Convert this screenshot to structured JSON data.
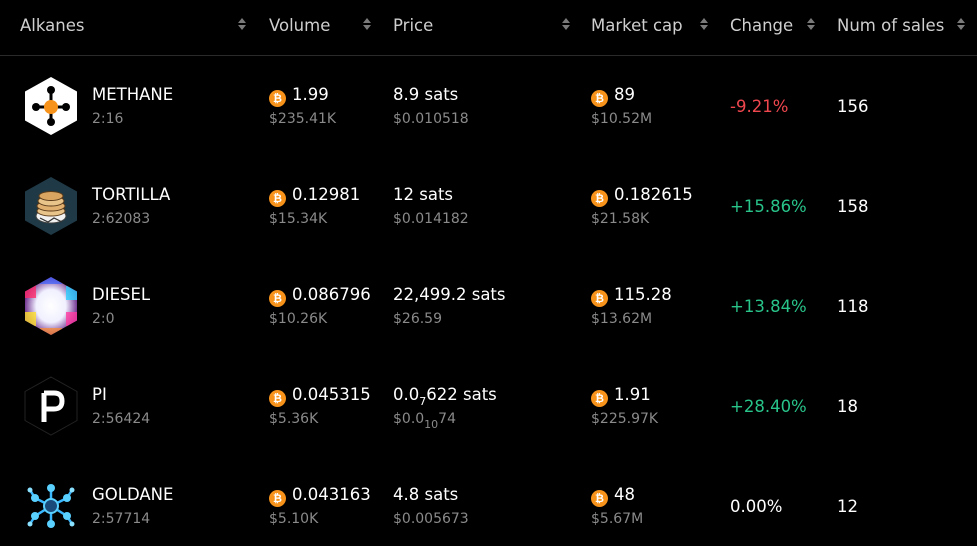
{
  "columns": {
    "alkanes": "Alkanes",
    "volume": "Volume",
    "price": "Price",
    "market_cap": "Market cap",
    "change": "Change",
    "num_sales": "Num of sales"
  },
  "currency_glyph": "₿",
  "colors": {
    "negative": "#f0474f",
    "positive": "#28c48a",
    "bitcoin": "#f7931a"
  },
  "rows": [
    {
      "name": "METHANE",
      "id": "2:16",
      "logo": "methane-molecule-icon",
      "volume_btc": "1.99",
      "volume_usd": "$235.41K",
      "price_sats": "8.9 sats",
      "price_usd": "$0.010518",
      "market_cap_btc": "89",
      "market_cap_usd": "$10.52M",
      "change": "-9.21%",
      "sales": "156"
    },
    {
      "name": "TORTILLA",
      "id": "2:62083",
      "logo": "tortilla-stack-icon",
      "volume_btc": "0.12981",
      "volume_usd": "$15.34K",
      "price_sats": "12 sats",
      "price_usd": "$0.014182",
      "market_cap_btc": "0.182615",
      "market_cap_usd": "$21.58K",
      "change": "+15.86%",
      "sales": "158"
    },
    {
      "name": "DIESEL",
      "id": "2:0",
      "logo": "diesel-rainbow-icon",
      "volume_btc": "0.086796",
      "volume_usd": "$10.26K",
      "price_sats": "22,499.2 sats",
      "price_usd": "$26.59",
      "market_cap_btc": "115.28",
      "market_cap_usd": "$13.62M",
      "change": "+13.84%",
      "sales": "118"
    },
    {
      "name": "PI",
      "id": "2:56424",
      "logo": "pi-letter-icon",
      "volume_btc": "0.045315",
      "volume_usd": "$5.36K",
      "price_sats_prefix": "0.0",
      "price_sats_zeros": "7",
      "price_sats_rest": "622 sats",
      "price_usd_prefix": "$0.0",
      "price_usd_zeros": "10",
      "price_usd_rest": "74",
      "market_cap_btc": "1.91",
      "market_cap_usd": "$225.97K",
      "change": "+28.40%",
      "sales": "18"
    },
    {
      "name": "GOLDANE",
      "id": "2:57714",
      "logo": "goldane-molecule-icon",
      "volume_btc": "0.043163",
      "volume_usd": "$5.10K",
      "price_sats": "4.8 sats",
      "price_usd": "$0.005673",
      "market_cap_btc": "48",
      "market_cap_usd": "$5.67M",
      "change": "0.00%",
      "sales": "12"
    }
  ]
}
